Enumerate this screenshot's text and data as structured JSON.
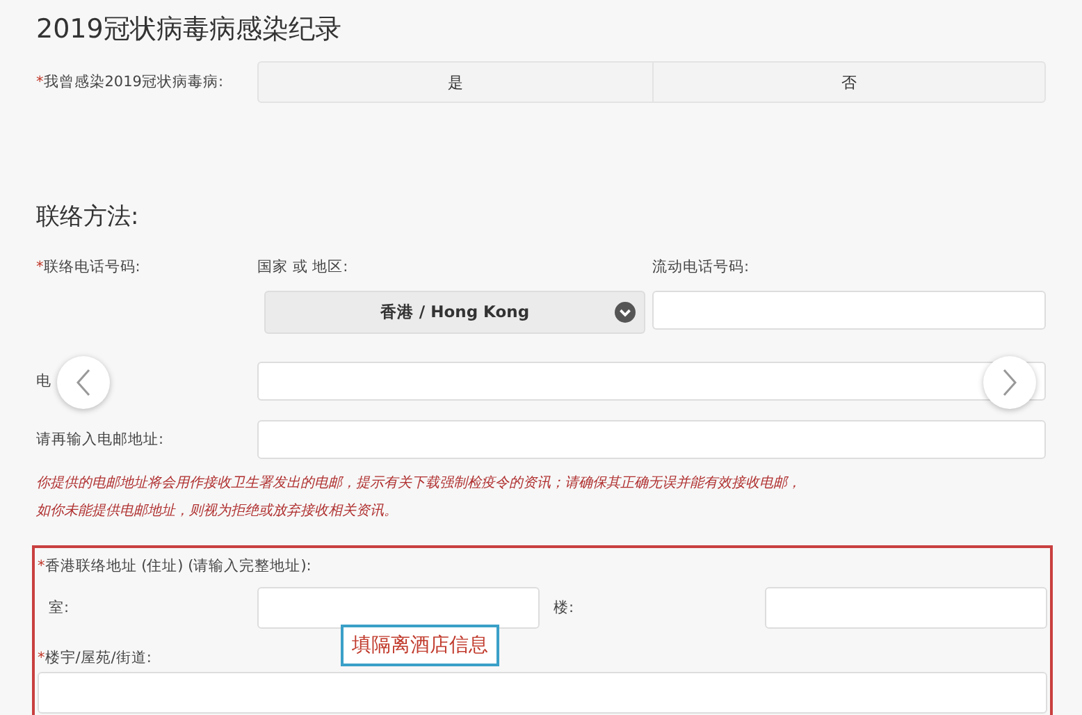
{
  "covid_section": {
    "title": "2019冠状病毒病感染纪录",
    "question": {
      "mark": "*",
      "label": "我曾感染2019冠状病毒病:"
    },
    "options": [
      {
        "label": "是",
        "selected": false
      },
      {
        "label": "否",
        "selected": false
      }
    ]
  },
  "contact_section": {
    "title": "联络方法:",
    "phone": {
      "mark": "*",
      "label": "联络电话号码:",
      "region_label": "国家 或 地区:",
      "mobile_label": "流动电话号码:",
      "region_value": "香港 / Hong Kong"
    },
    "email_label": "电",
    "email_confirm_label": "请再输入电邮地址:",
    "notes": [
      "你提供的电邮地址将会用作接收卫生署发出的电邮，提示有关下载强制检疫令的资讯；请确保其正确无误并能有效接收电邮，",
      "如你未能提供电邮地址，则视为拒绝或放弃接收相关资讯。"
    ],
    "address": {
      "mark": "*",
      "label": "香港联络地址 (住址) (请输入完整地址):",
      "room_label": "室:",
      "floor_label": "楼:",
      "street_mark": "*",
      "street_label": "楼宇/屋苑/街道:"
    }
  },
  "annotation": "填隔离酒店信息"
}
